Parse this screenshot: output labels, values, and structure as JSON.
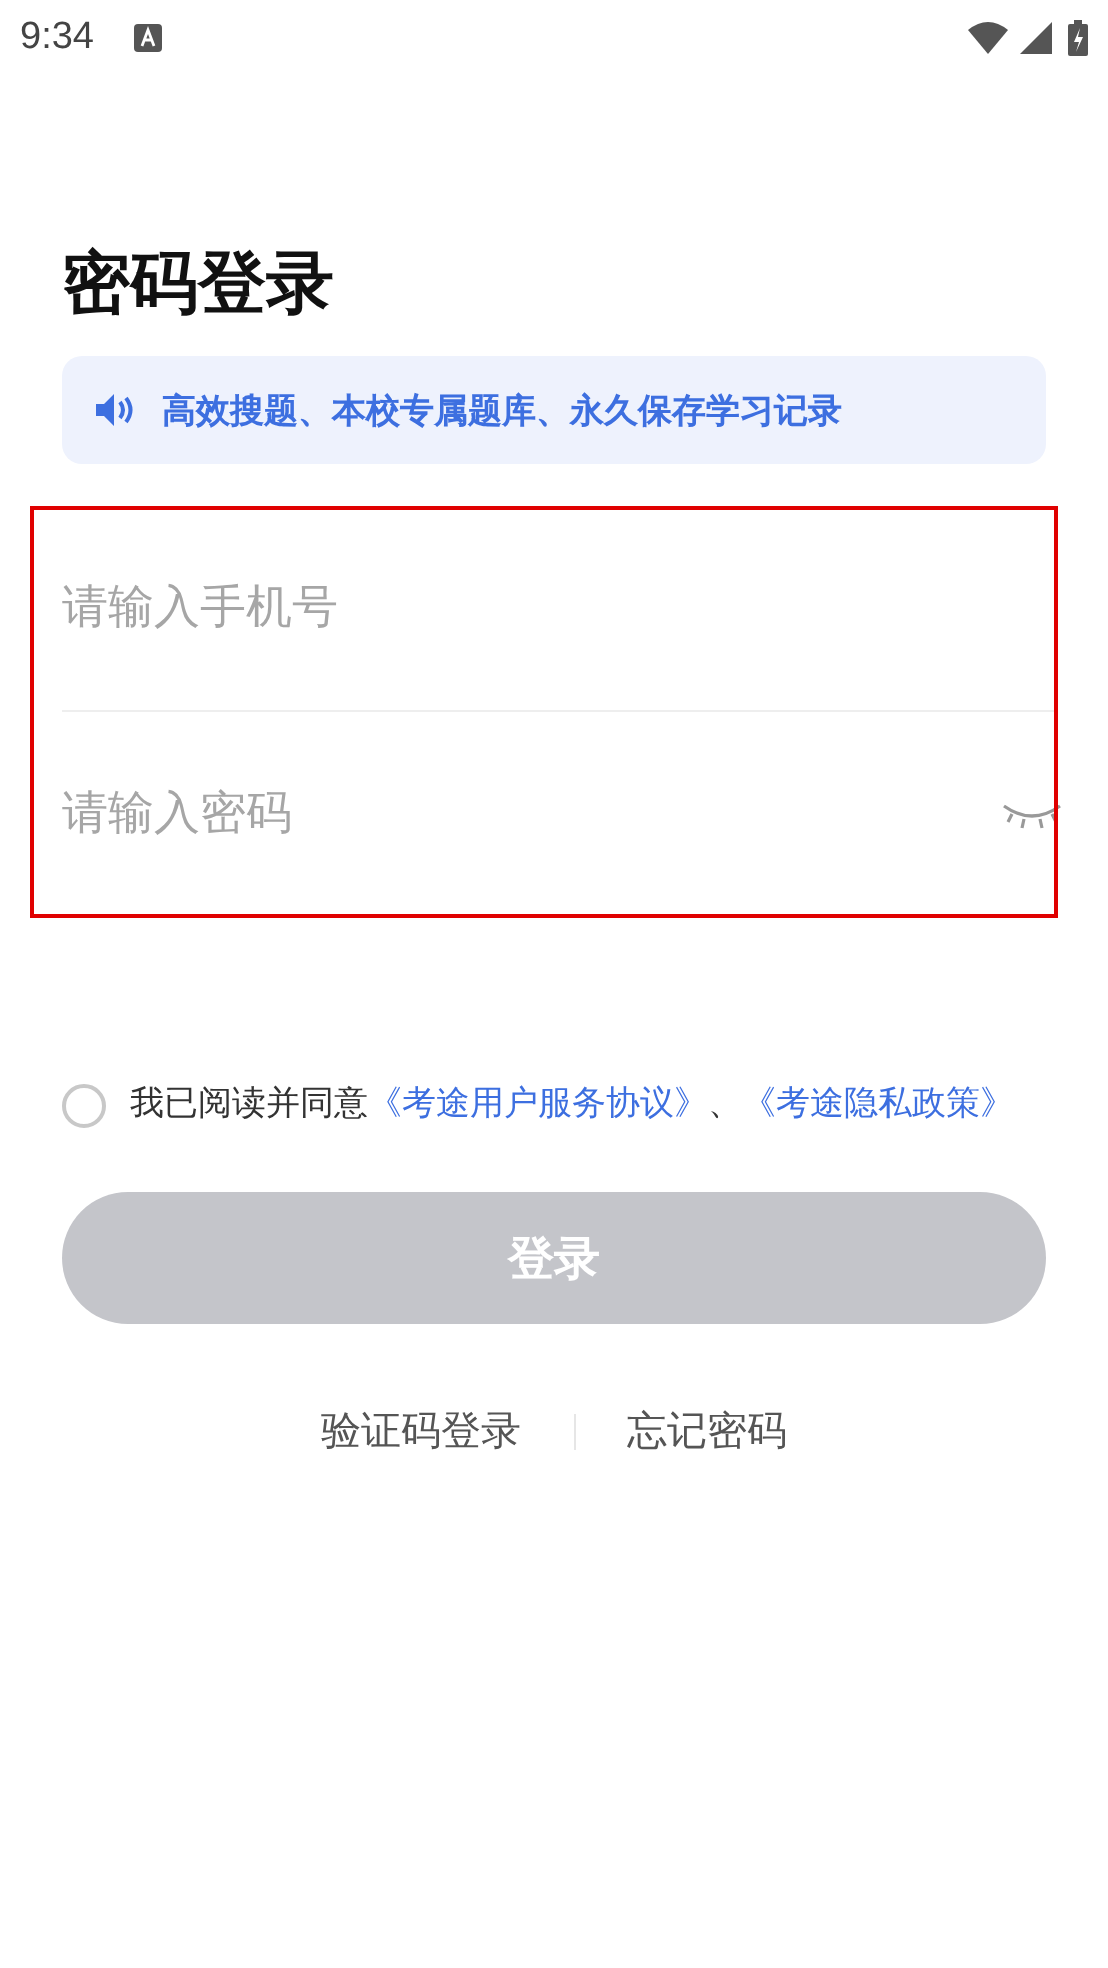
{
  "status_bar": {
    "time": "9:34"
  },
  "title": "密码登录",
  "banner": {
    "text": "高效搜题、本校专属题库、永久保存学习记录"
  },
  "form": {
    "highlighted": true,
    "fields": [
      {
        "kind": "phone",
        "placeholder": "请输入手机号"
      },
      {
        "kind": "password",
        "placeholder": "请输入密码",
        "password_visible": false
      }
    ]
  },
  "agreement": {
    "agreed": false,
    "parts": [
      {
        "kind": "text",
        "text": "我已阅读并同意"
      },
      {
        "kind": "link",
        "text": "《考途用户服务协议》"
      },
      {
        "kind": "text",
        "text": "、"
      },
      {
        "kind": "link",
        "text": "《考途隐私政策》"
      }
    ]
  },
  "login_button": {
    "label": "登录",
    "disabled": true
  },
  "bottom_links": [
    "验证码登录",
    "忘记密码"
  ]
}
